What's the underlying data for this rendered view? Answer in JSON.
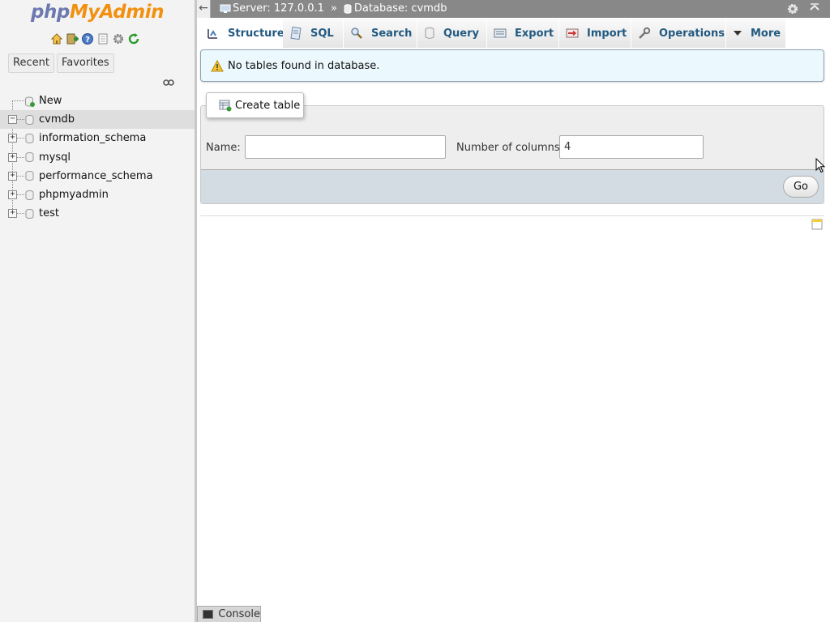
{
  "logo": {
    "php": "php",
    "my": "My",
    "admin": "Admin"
  },
  "nav": {
    "icons": [
      "home-icon",
      "exit-icon",
      "help-icon",
      "docs-icon",
      "gear-icon",
      "reload-icon"
    ],
    "recent_label": "Recent",
    "favorites_label": "Favorites",
    "tree": [
      {
        "label": "New",
        "type": "new",
        "expander": ""
      },
      {
        "label": "cvmdb",
        "type": "db",
        "expander": "−",
        "selected": true
      },
      {
        "label": "information_schema",
        "type": "db",
        "expander": "+"
      },
      {
        "label": "mysql",
        "type": "db",
        "expander": "+"
      },
      {
        "label": "performance_schema",
        "type": "db",
        "expander": "+"
      },
      {
        "label": "phpmyadmin",
        "type": "db",
        "expander": "+"
      },
      {
        "label": "test",
        "type": "db",
        "expander": "+"
      }
    ]
  },
  "breadcrumb": {
    "server": "Server: 127.0.0.1",
    "separator": "»",
    "database": "Database: cvmdb"
  },
  "tabs": {
    "structure": "Structure",
    "sql": "SQL",
    "search": "Search",
    "query": "Query",
    "export": "Export",
    "import": "Import",
    "operations": "Operations",
    "more": "More"
  },
  "notice": {
    "text": "No tables found in database."
  },
  "create_table": {
    "legend": "Create table",
    "name_label": "Name:",
    "name_value": "",
    "columns_label": "Number of columns:",
    "columns_value": "4",
    "go_label": "Go"
  },
  "console": {
    "label": "Console"
  },
  "colors": {
    "tab_text": "#235a81",
    "topbar_bg": "#888888",
    "notice_bg": "#ebf8fd",
    "go_bar_bg": "#d3dce3"
  }
}
